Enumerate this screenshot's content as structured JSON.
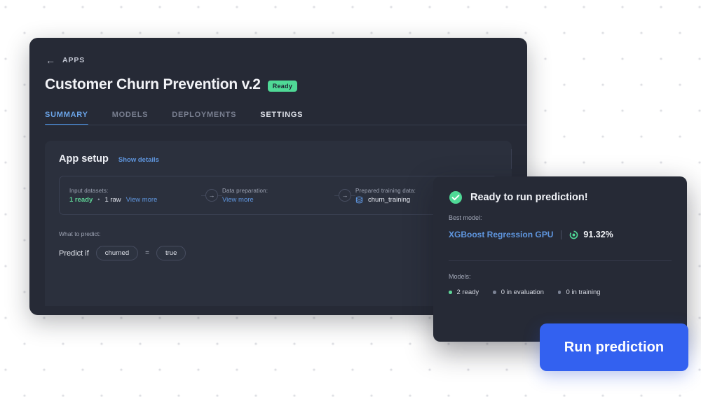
{
  "background": {
    "dot_color": "#d9dae0",
    "page_bg": "#ffffff"
  },
  "colors": {
    "window_bg": "#262a36",
    "card_bg": "#2b303d",
    "accent_blue": "#5f96df",
    "button_blue": "#3361f0",
    "success_green": "#4fd996",
    "muted_text": "#9ea4b4"
  },
  "window": {
    "breadcrumb": {
      "back_icon": "arrow-left-icon",
      "label": "APPS"
    },
    "title": "Customer Churn Prevention v.2",
    "status_badge": "Ready",
    "tabs": [
      {
        "label": "SUMMARY",
        "active": true
      },
      {
        "label": "MODELS",
        "active": false
      },
      {
        "label": "DEPLOYMENTS",
        "active": false
      },
      {
        "label": "SETTINGS",
        "active": false
      }
    ]
  },
  "app_setup": {
    "section_title": "App setup",
    "show_details_label": "Show details",
    "steps": [
      {
        "label": "Input datasets:",
        "ready_count": "1 ready",
        "separator": "•",
        "raw_count": "1 raw",
        "link": "View more"
      },
      {
        "label": "Data preparation:",
        "link": "View more"
      },
      {
        "label": "Prepared training data:",
        "icon": "database-icon",
        "dataset_name": "churn_training"
      }
    ],
    "arrow_icon": "arrow-right-circle-icon"
  },
  "predict": {
    "label": "What to predict:",
    "prefix": "Predict if",
    "field": "churned",
    "operator": "=",
    "value": "true"
  },
  "prediction_card": {
    "status_icon": "check-circle-icon",
    "title": "Ready to run prediction!",
    "best_model_label": "Best model:",
    "model_name": "XGBoost Regression GPU",
    "accuracy_icon": "gauge-icon",
    "accuracy": "91.32%",
    "models_label": "Models:",
    "stats": [
      {
        "text": "2 ready",
        "state": "green"
      },
      {
        "text": "0 in evaluation",
        "state": "muted"
      },
      {
        "text": "0 in training",
        "state": "muted"
      }
    ]
  },
  "actions": {
    "run_prediction_label": "Run prediction"
  }
}
